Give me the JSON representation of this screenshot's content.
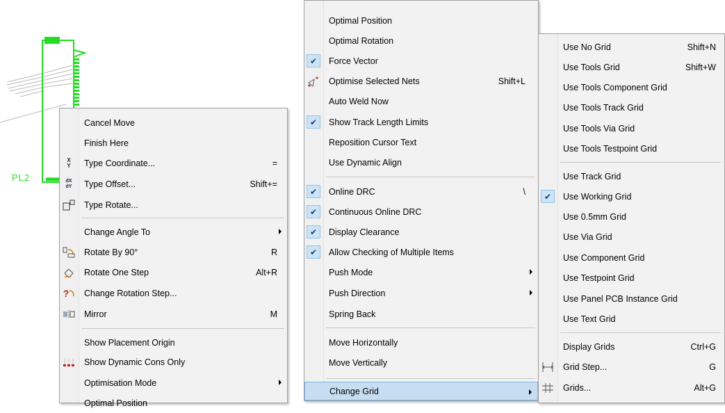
{
  "canvas": {
    "component_label": "PL2",
    "trace_color": "#22dd22"
  },
  "menu_left": {
    "items": [
      {
        "label": "Cancel Move",
        "shortcut": "",
        "icon": ""
      },
      {
        "label": "Finish Here",
        "shortcut": "",
        "icon": ""
      },
      {
        "label": "Type Coordinate...",
        "shortcut": "=",
        "icon": "xy-coordinate-icon"
      },
      {
        "label": "Type Offset...",
        "shortcut": "Shift+=",
        "icon": "dx-dy-offset-icon"
      },
      {
        "label": "Type Rotate...",
        "shortcut": "",
        "icon": "rotate-boxes-icon"
      },
      {
        "label": "Change Angle To",
        "shortcut": "",
        "icon": "",
        "submenu": true
      },
      {
        "label": "Rotate By 90°",
        "shortcut": "R",
        "icon": "rotate-90-icon"
      },
      {
        "label": "Rotate One Step",
        "shortcut": "Alt+R",
        "icon": "rotate-step-icon"
      },
      {
        "label": "Change Rotation Step...",
        "shortcut": "",
        "icon": "rotation-step-question-icon"
      },
      {
        "label": "Mirror",
        "shortcut": "M",
        "icon": "mirror-icon"
      },
      {
        "label": "Show Placement Origin",
        "shortcut": "",
        "icon": ""
      },
      {
        "label": "Show Dynamic Cons Only",
        "shortcut": "",
        "icon": "dynamic-cons-icon"
      },
      {
        "label": "Optimisation Mode",
        "shortcut": "",
        "icon": "",
        "submenu": true
      },
      {
        "label": "Optimal Position",
        "shortcut": "",
        "icon": ""
      }
    ]
  },
  "menu_middle": {
    "items": [
      {
        "label": "Optimal Position",
        "shortcut": ""
      },
      {
        "label": "Optimal Rotation",
        "shortcut": ""
      },
      {
        "label": "Force Vector",
        "shortcut": "",
        "checked": true
      },
      {
        "label": "Optimise Selected Nets",
        "shortcut": "Shift+L",
        "icon": "optimise-nets-icon"
      },
      {
        "label": "Auto Weld Now",
        "shortcut": ""
      },
      {
        "label": "Show Track Length Limits",
        "shortcut": "",
        "checked": true
      },
      {
        "label": "Reposition Cursor Text",
        "shortcut": ""
      },
      {
        "label": "Use Dynamic Align",
        "shortcut": ""
      },
      {
        "label": "Online DRC",
        "shortcut": "\\",
        "checked": true
      },
      {
        "label": "Continuous Online DRC",
        "shortcut": "",
        "checked": true
      },
      {
        "label": "Display Clearance",
        "shortcut": "",
        "checked": true
      },
      {
        "label": "Allow Checking of Multiple Items",
        "shortcut": "",
        "checked": true
      },
      {
        "label": "Push Mode",
        "shortcut": "",
        "submenu": true
      },
      {
        "label": "Push Direction",
        "shortcut": "",
        "submenu": true
      },
      {
        "label": "Spring Back",
        "shortcut": ""
      },
      {
        "label": "Move Horizontally",
        "shortcut": ""
      },
      {
        "label": "Move Vertically",
        "shortcut": ""
      },
      {
        "label": "Change Grid",
        "shortcut": "",
        "submenu": true,
        "highlighted": true
      }
    ]
  },
  "menu_right": {
    "items": [
      {
        "label": "Use No Grid",
        "shortcut": "Shift+N"
      },
      {
        "label": "Use Tools  Grid",
        "shortcut": "Shift+W"
      },
      {
        "label": "Use Tools Component Grid",
        "shortcut": ""
      },
      {
        "label": "Use Tools Track Grid",
        "shortcut": ""
      },
      {
        "label": "Use Tools Via Grid",
        "shortcut": ""
      },
      {
        "label": "Use Tools Testpoint Grid",
        "shortcut": ""
      },
      {
        "label": "Use Track Grid",
        "shortcut": ""
      },
      {
        "label": "Use Working Grid",
        "shortcut": "",
        "checked": true
      },
      {
        "label": "Use 0.5mm Grid",
        "shortcut": ""
      },
      {
        "label": "Use Via Grid",
        "shortcut": ""
      },
      {
        "label": "Use Component Grid",
        "shortcut": ""
      },
      {
        "label": "Use Testpoint Grid",
        "shortcut": ""
      },
      {
        "label": "Use Panel PCB Instance Grid",
        "shortcut": ""
      },
      {
        "label": "Use Text Grid",
        "shortcut": ""
      },
      {
        "label": "Display Grids",
        "shortcut": "Ctrl+G"
      },
      {
        "label": "Grid Step...",
        "shortcut": "G",
        "icon": "grid-step-icon"
      },
      {
        "label": "Grids...",
        "shortcut": "Alt+G",
        "icon": "grids-icon"
      }
    ]
  },
  "symbols": {
    "check": "✔",
    "xy_top": "X",
    "xy_bottom": "Y",
    "dx_top": "dX",
    "dx_bottom": "dY",
    "question": "?",
    "grid_glyph": "#"
  }
}
